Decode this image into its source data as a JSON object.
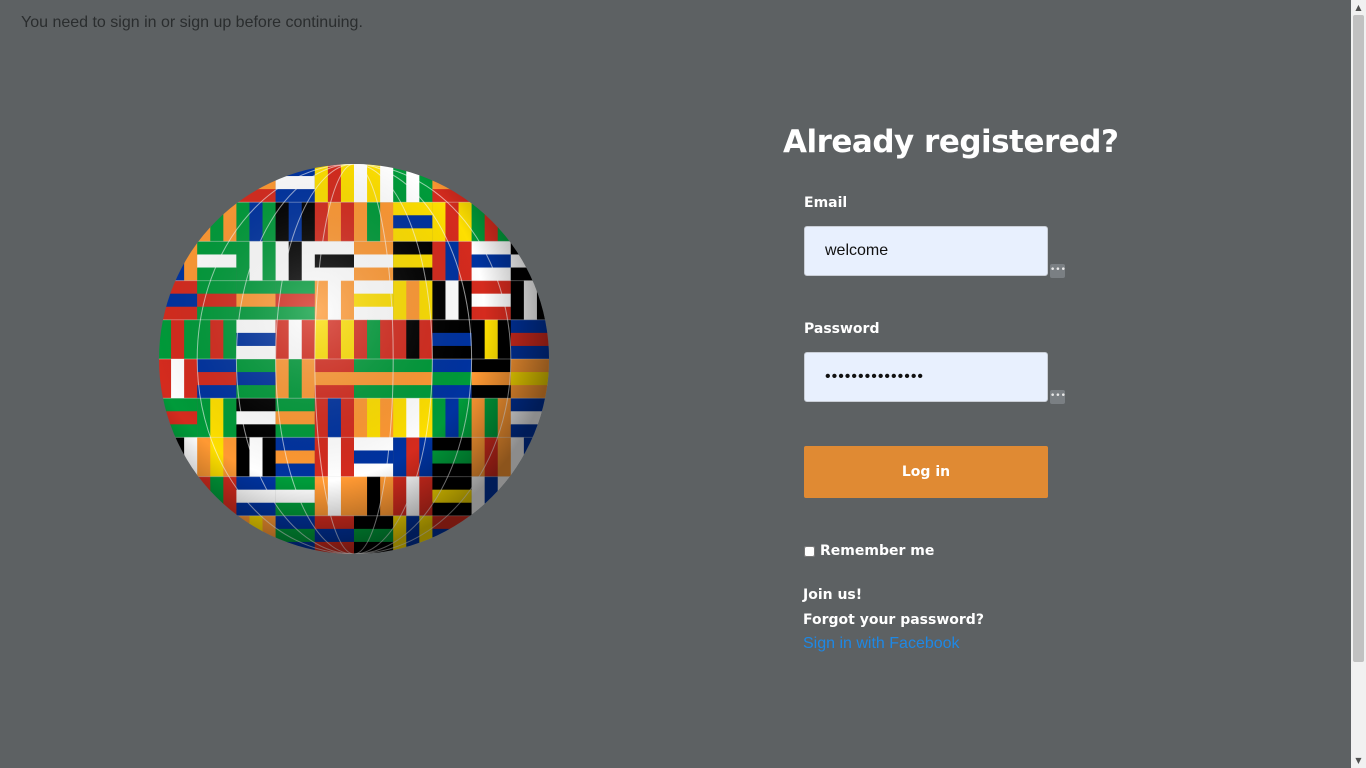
{
  "flash_message": "You need to sign in or sign up before continuing.",
  "globe_image": {
    "icon": "flags-globe-image",
    "colors": [
      "#d52b1e",
      "#ffffff",
      "#0033a0",
      "#009b3a",
      "#fedf00",
      "#000000",
      "#ff9933"
    ]
  },
  "form": {
    "heading": "Already registered?",
    "email_label": "Email",
    "email_value": "welcome",
    "password_label": "Password",
    "password_value": "•••••••••••••••",
    "password_manager_icon": "•••",
    "login_button": "Log in",
    "remember_label": "Remember me",
    "remember_checked": false
  },
  "links": {
    "join": "Join us!",
    "forgot": "Forgot your password?",
    "facebook": "Sign in with Facebook"
  },
  "colors": {
    "background": "#5d6163",
    "button": "#e08a33",
    "input_bg": "#e8f0fe",
    "link_blue": "#1e88e5"
  }
}
